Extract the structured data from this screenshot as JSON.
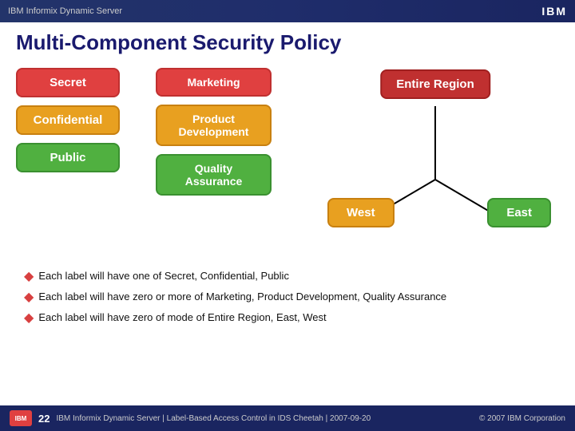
{
  "header": {
    "title": "IBM Informix Dynamic Server",
    "logo": "IBM"
  },
  "page": {
    "title": "Multi-Component Security Policy"
  },
  "labels": {
    "secret": "Secret",
    "confidential": "Confidential",
    "public": "Public"
  },
  "middle_boxes": {
    "marketing": "Marketing",
    "product_development": "Product Development",
    "quality_assurance": "Quality Assurance"
  },
  "right_boxes": {
    "entire_region": "Entire Region",
    "west": "West",
    "east": "East"
  },
  "bullets": [
    "Each label will have one of Secret, Confidential, Public",
    "Each label will have zero or more of Marketing, Product Development, Quality Assurance",
    "Each label will have zero of mode of Entire Region, East, West"
  ],
  "footer": {
    "page_number": "22",
    "text": "IBM Informix Dynamic Server | Label-Based Access Control in IDS Cheetah | 2007-09-20",
    "copyright": "© 2007 IBM Corporation",
    "dynamic_server": "Dynamic Server"
  }
}
